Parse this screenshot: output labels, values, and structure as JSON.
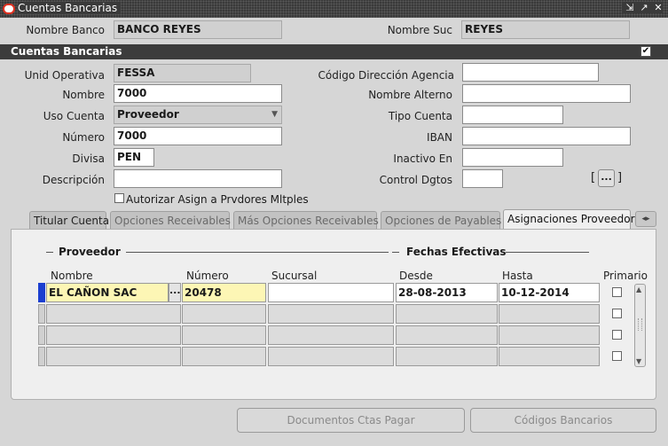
{
  "window": {
    "title": "Cuentas Bancarias",
    "icons": [
      "oracle-icon",
      "minimize-icon",
      "maximize-icon",
      "close-icon"
    ],
    "controls": [
      "⇲",
      "↗",
      "✕"
    ]
  },
  "header": {
    "nombre_banco_label": "Nombre Banco",
    "nombre_banco_value": "BANCO REYES",
    "nombre_suc_label": "Nombre Suc",
    "nombre_suc_value": "REYES"
  },
  "section": {
    "title": "Cuentas Bancarias",
    "checked": true
  },
  "form": {
    "unid_operativa_label": "Unid Operativa",
    "unid_operativa_value": "FESSA",
    "nombre_label": "Nombre",
    "nombre_value": "7000",
    "uso_cuenta_label": "Uso Cuenta",
    "uso_cuenta_value": "Proveedor",
    "numero_label": "Número",
    "numero_value": "7000",
    "divisa_label": "Divisa",
    "divisa_value": "PEN",
    "descripcion_label": "Descripción",
    "descripcion_value": "",
    "codigo_direccion_label": "Código Dirección Agencia",
    "codigo_direccion_value": "",
    "nombre_alterno_label": "Nombre Alterno",
    "nombre_alterno_value": "",
    "tipo_cuenta_label": "Tipo Cuenta",
    "tipo_cuenta_value": "",
    "iban_label": "IBAN",
    "iban_value": "",
    "inactivo_en_label": "Inactivo En",
    "inactivo_en_value": "",
    "control_dgtos_label": "Control Dgtos",
    "control_dgtos_value": "",
    "autorizar_label": "Autorizar Asign a Prvdores Mltples",
    "autorizar_checked": false,
    "flex_open": "[",
    "flex_button": "...",
    "flex_close": "]"
  },
  "tabs": [
    {
      "label": "Titular Cuenta",
      "active": false
    },
    {
      "label": "Opciones Receivables",
      "active": false
    },
    {
      "label": "Más Opciones Receivables",
      "active": false
    },
    {
      "label": "Opciones de Payables",
      "active": false
    },
    {
      "label": "Asignaciones Proveedor",
      "active": true
    }
  ],
  "tab_scroll": "◂▸",
  "panel": {
    "group_proveedor": "Proveedor",
    "group_fechas": "Fechas Efectivas",
    "columns": {
      "nombre": "Nombre",
      "numero": "Número",
      "sucursal": "Sucursal",
      "desde": "Desde",
      "hasta": "Hasta",
      "primario": "Primario"
    },
    "rows": [
      {
        "nombre": "EL CAÑON SAC",
        "lov": "...",
        "numero": "20478",
        "sucursal": "",
        "desde": "28-08-2013",
        "hasta": "10-12-2014",
        "primario": false
      },
      {
        "nombre": "",
        "lov": "",
        "numero": "",
        "sucursal": "",
        "desde": "",
        "hasta": "",
        "primario": false
      },
      {
        "nombre": "",
        "lov": "",
        "numero": "",
        "sucursal": "",
        "desde": "",
        "hasta": "",
        "primario": false
      },
      {
        "nombre": "",
        "lov": "",
        "numero": "",
        "sucursal": "",
        "desde": "",
        "hasta": "",
        "primario": false
      }
    ]
  },
  "buttons": {
    "documentos": "Documentos Ctas Pagar",
    "codigos": "Códigos Bancarios"
  }
}
